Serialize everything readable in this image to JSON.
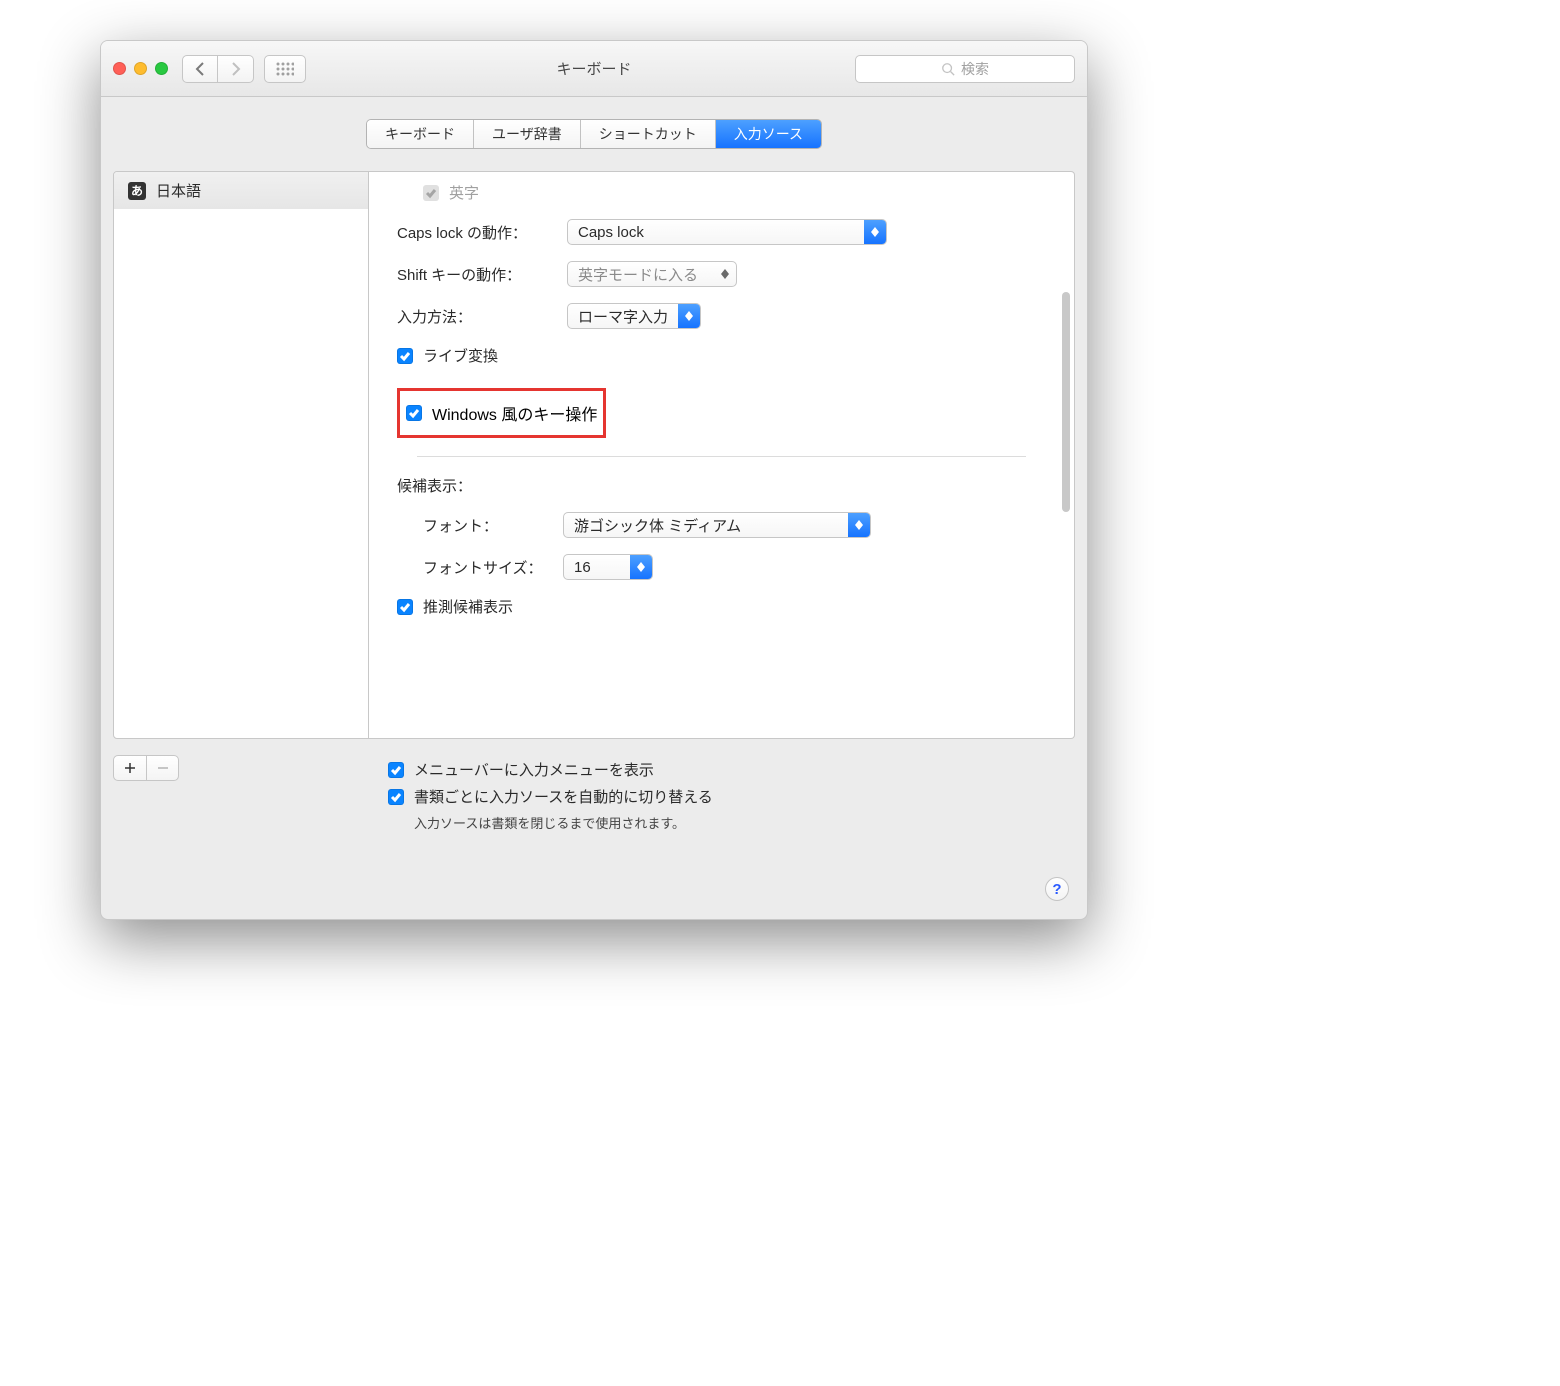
{
  "window": {
    "title": "キーボード"
  },
  "search": {
    "placeholder": "検索"
  },
  "tabs": {
    "items": [
      "キーボード",
      "ユーザ辞書",
      "ショートカット",
      "入力ソース"
    ],
    "selected": 3
  },
  "sidebar": {
    "items": [
      {
        "icon": "あ",
        "label": "日本語"
      }
    ]
  },
  "settings": {
    "eiji_label": "英字",
    "capslock": {
      "label": "Caps lock の動作：",
      "value": "Caps lock"
    },
    "shift": {
      "label": "Shift キーの動作：",
      "value": "英字モードに入る"
    },
    "input_method": {
      "label": "入力方法：",
      "value": "ローマ字入力"
    },
    "live_conversion": {
      "label": "ライブ変換",
      "checked": true
    },
    "windows_keys": {
      "label": "Windows 風のキー操作",
      "checked": true
    },
    "candidate_header": "候補表示：",
    "font": {
      "label": "フォント：",
      "value": "游ゴシック体 ミディアム"
    },
    "font_size": {
      "label": "フォントサイズ：",
      "value": "16"
    },
    "predictive": {
      "label": "推測候補表示",
      "checked": true
    }
  },
  "bottom": {
    "menubar": {
      "label": "メニューバーに入力メニューを表示",
      "checked": true
    },
    "autoswitch": {
      "label": "書類ごとに入力ソースを自動的に切り替える",
      "checked": true
    },
    "hint": "入力ソースは書類を閉じるまで使用されます。"
  },
  "help": "?"
}
